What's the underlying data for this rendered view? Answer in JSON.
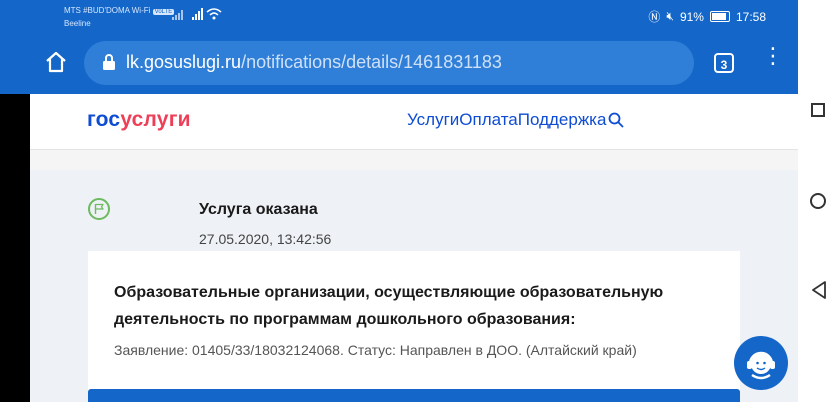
{
  "status_bar": {
    "carrier1": "MTS #BUD'DOMA Wi-Fi",
    "carrier2": "Beeline",
    "volte_badge": "VoLTE",
    "battery": "91%",
    "time": "17:58"
  },
  "browser": {
    "url_domain": "lk.gosuslugi.ru",
    "url_path": "/notifications/details/1461831183",
    "tab_count": "3"
  },
  "site": {
    "logo_part1": "гос",
    "logo_part2": "услуги",
    "nav_services": "Услуги",
    "nav_payment": "Оплата",
    "nav_support": "Поддержка"
  },
  "event": {
    "title": "Услуга оказана",
    "date": "27.05.2020, 13:42:56"
  },
  "card": {
    "title": "Образовательные организации, осуществляющие образовательную деятельность по программам дошкольного образования:",
    "meta": "Заявление: 01405/33/18032124068. Статус: Направлен в ДОО. (Алтайский край)"
  },
  "colors": {
    "brand_blue": "#0d4cd3",
    "brand_red": "#ee3f58",
    "chrome_blue": "#1467c8",
    "success_green": "#6cbb5e"
  }
}
